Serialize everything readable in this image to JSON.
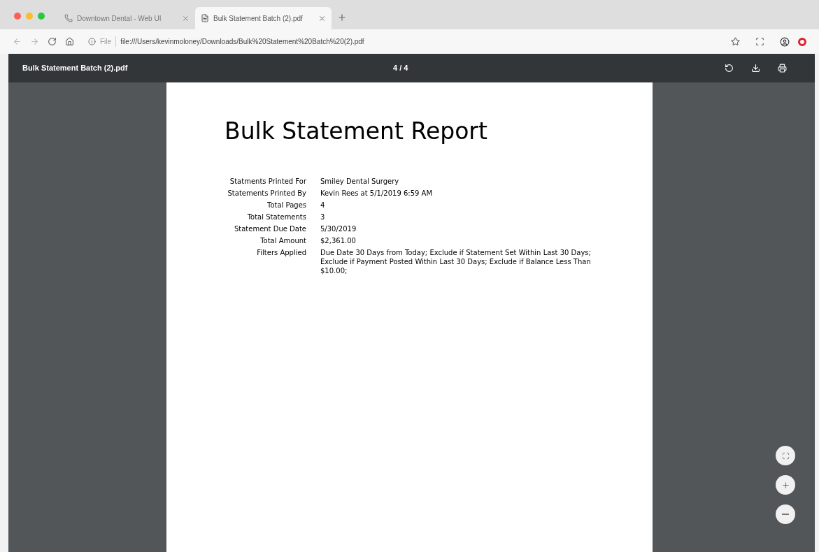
{
  "tabs": [
    {
      "title": "Downtown Dental - Web UI",
      "selected": false
    },
    {
      "title": "Bulk Statement Batch (2).pdf",
      "selected": true
    }
  ],
  "address_bar": {
    "chip": "File",
    "url": "file:///Users/kevinmoloney/Downloads/Bulk%20Statement%20Batch%20(2).pdf"
  },
  "viewer": {
    "file_name": "Bulk Statement Batch (2).pdf",
    "page_indicator": "4 / 4"
  },
  "document": {
    "title": "Bulk Statement Report",
    "rows": [
      {
        "label": "Statments Printed For",
        "value": "Smiley Dental Surgery"
      },
      {
        "label": "Statements Printed By",
        "value": "Kevin Rees at 5/1/2019 6:59 AM"
      },
      {
        "label": "Total Pages",
        "value": "4"
      },
      {
        "label": "Total Statements",
        "value": "3"
      },
      {
        "label": "Statement Due Date",
        "value": "5/30/2019"
      },
      {
        "label": "Total Amount",
        "value": "$2,361.00"
      },
      {
        "label": "Filters Applied",
        "value": "Due Date 30 Days from Today; Exclude if Statement Set Within Last 30 Days; Exclude if Payment Posted Within Last 30 Days; Exclude if Balance Less Than $10.00;"
      }
    ]
  }
}
